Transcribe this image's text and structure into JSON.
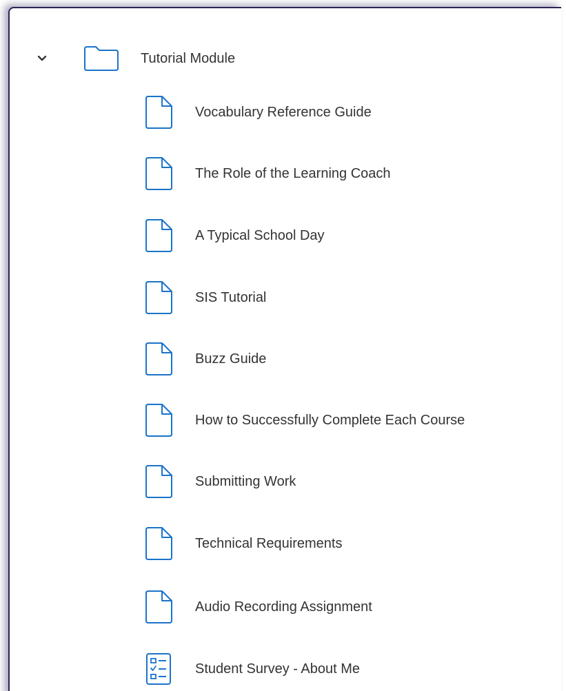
{
  "module": {
    "label": "Tutorial Module",
    "expand_icon": "chevron-down-icon",
    "folder_icon": "folder-icon"
  },
  "items": [
    {
      "label": "Vocabulary Reference Guide",
      "icon": "page-icon"
    },
    {
      "label": "The Role of the Learning Coach",
      "icon": "page-icon"
    },
    {
      "label": "A Typical School Day",
      "icon": "page-icon"
    },
    {
      "label": "SIS Tutorial",
      "icon": "page-icon"
    },
    {
      "label": "Buzz Guide",
      "icon": "page-icon"
    },
    {
      "label": "How to Successfully Complete Each Course",
      "icon": "page-icon"
    },
    {
      "label": "Submitting Work",
      "icon": "page-icon"
    },
    {
      "label": "Technical Requirements",
      "icon": "page-icon"
    },
    {
      "label": "Audio Recording Assignment",
      "icon": "page-icon"
    },
    {
      "label": "Student Survey - About Me",
      "icon": "survey-icon"
    }
  ],
  "colors": {
    "icon_blue": "#1a73c9",
    "text": "#333333",
    "panel_border": "#2a2458"
  }
}
